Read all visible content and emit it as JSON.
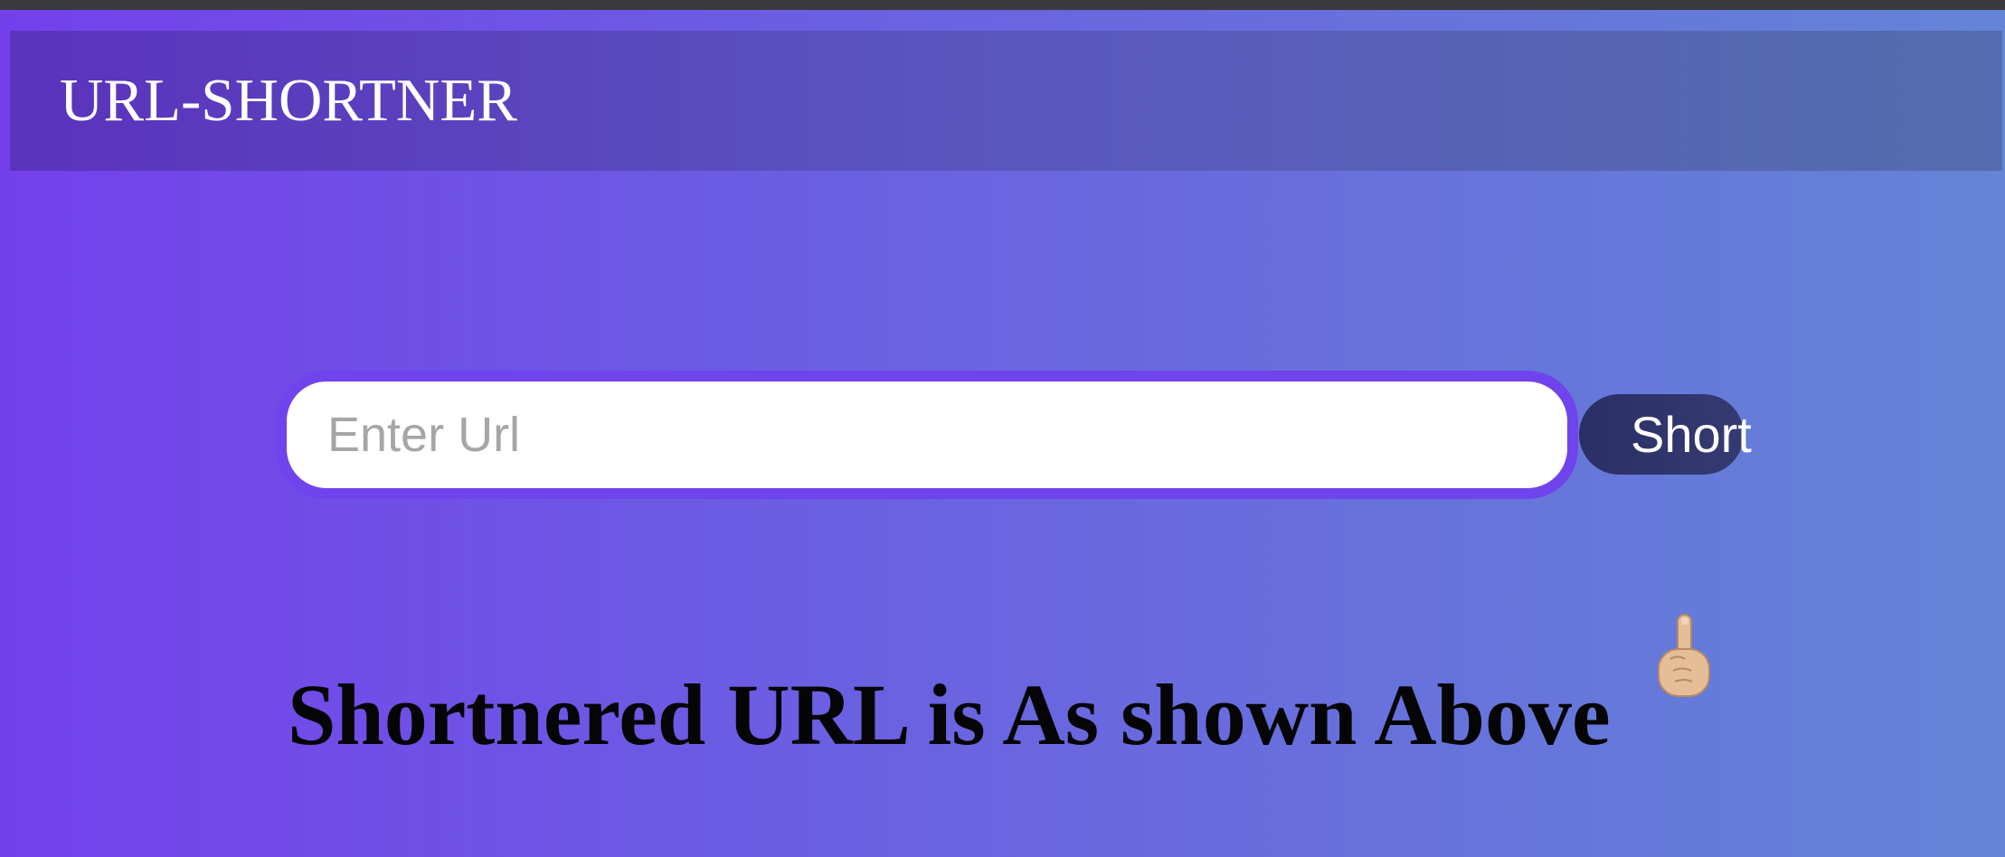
{
  "navbar": {
    "brand": "URL-SHORTNER"
  },
  "form": {
    "url_value": "",
    "url_placeholder": "Enter Url",
    "submit_label": "Short"
  },
  "result": {
    "message": "Shortnered URL is As shown Above",
    "icon": "pointing-up-hand-icon"
  },
  "colors": {
    "background_start": "#7440ec",
    "background_end": "#6484d6",
    "input_border": "#7044ec",
    "button_background": "#2f3469"
  }
}
